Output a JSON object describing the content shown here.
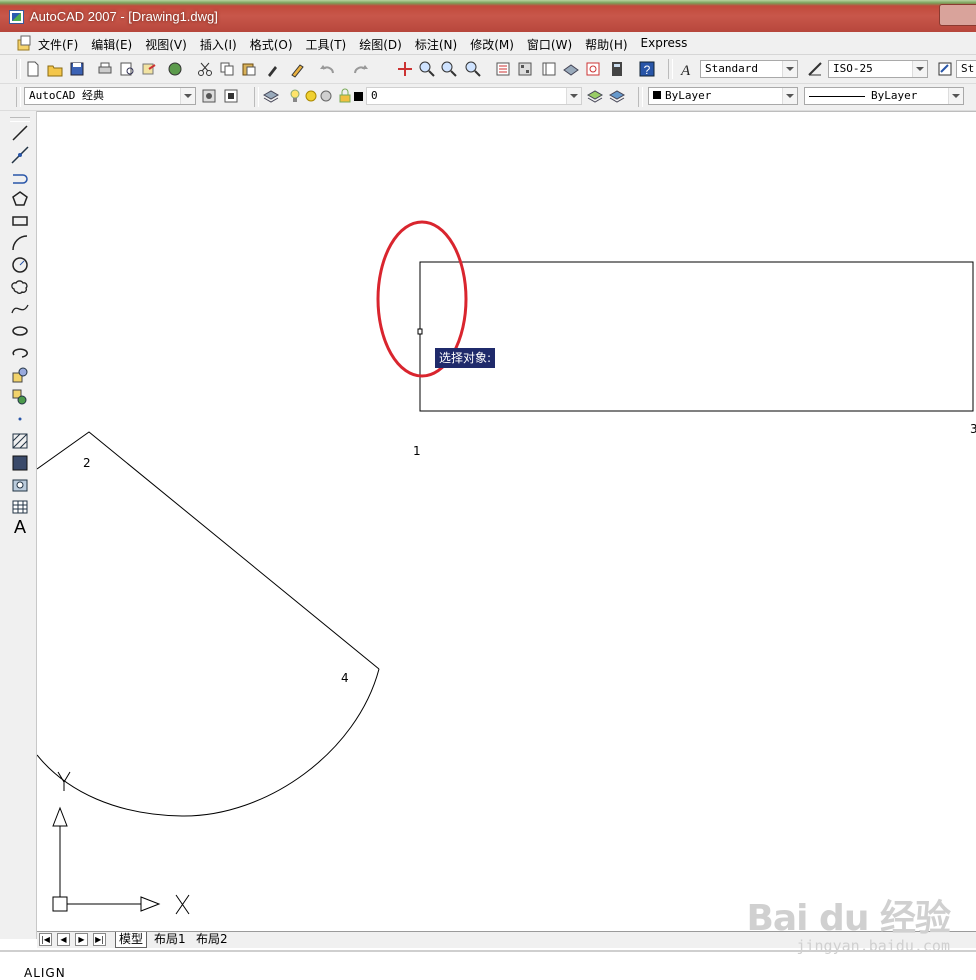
{
  "window": {
    "title": "AutoCAD 2007 - [Drawing1.dwg]"
  },
  "menubar": {
    "items": [
      "文件(F)",
      "编辑(E)",
      "视图(V)",
      "插入(I)",
      "格式(O)",
      "工具(T)",
      "绘图(D)",
      "标注(N)",
      "修改(M)",
      "窗口(W)",
      "帮助(H)",
      "Express"
    ]
  },
  "toolbar1": {
    "text_style": "Standard",
    "dim_style": "ISO-25",
    "table_style": "St"
  },
  "toolbar2": {
    "workspace": "AutoCAD 经典",
    "layer": "0",
    "color": "ByLayer",
    "linetype": "ByLayer"
  },
  "drawbar": {
    "tools": [
      "line-icon",
      "construction-line-icon",
      "polyline-icon",
      "polygon-icon",
      "rectangle-icon",
      "arc-icon",
      "circle-icon",
      "revision-cloud-icon",
      "spline-icon",
      "ellipse-icon",
      "ellipse-arc-icon",
      "insert-block-icon",
      "make-block-icon",
      "point-icon",
      "hatch-icon",
      "gradient-icon",
      "region-icon",
      "table-icon",
      "multiline-text-icon"
    ],
    "text_tool": "A"
  },
  "canvas": {
    "tooltip": "选择对象:",
    "point_labels": {
      "p1": "1",
      "p2": "2",
      "p3": "3",
      "p4": "4"
    },
    "ucs": {
      "x_label": "X",
      "y_label": "Y"
    },
    "highlight_color": "#d9252e"
  },
  "tabs": {
    "model": "模型",
    "layout1": "布局1",
    "layout2": "布局2"
  },
  "commandline": {
    "text": "ALIGN"
  },
  "watermark": {
    "brand": "Bai du 经验",
    "url": "jingyan.baidu.com"
  }
}
